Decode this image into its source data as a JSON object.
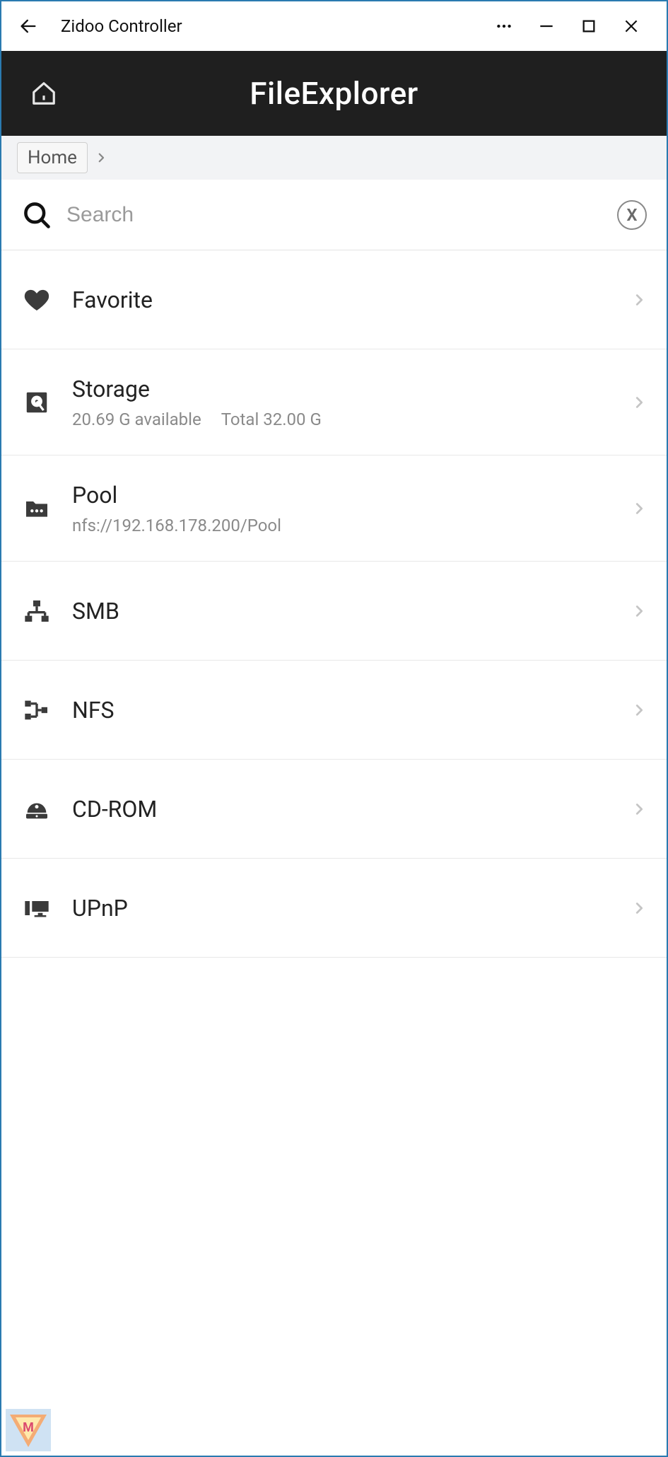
{
  "window": {
    "title": "Zidoo Controller"
  },
  "appbar": {
    "title": "FileExplorer"
  },
  "breadcrumb": {
    "items": [
      "Home"
    ]
  },
  "search": {
    "placeholder": "Search",
    "value": "",
    "clear_label": "X"
  },
  "list": {
    "favorite": {
      "label": "Favorite"
    },
    "storage": {
      "label": "Storage",
      "available": "20.69 G available",
      "total": "Total 32.00 G"
    },
    "pool": {
      "label": "Pool",
      "path": "nfs://192.168.178.200/Pool"
    },
    "smb": {
      "label": "SMB"
    },
    "nfs": {
      "label": "NFS"
    },
    "cdrom": {
      "label": "CD-ROM"
    },
    "upnp": {
      "label": "UPnP"
    }
  }
}
